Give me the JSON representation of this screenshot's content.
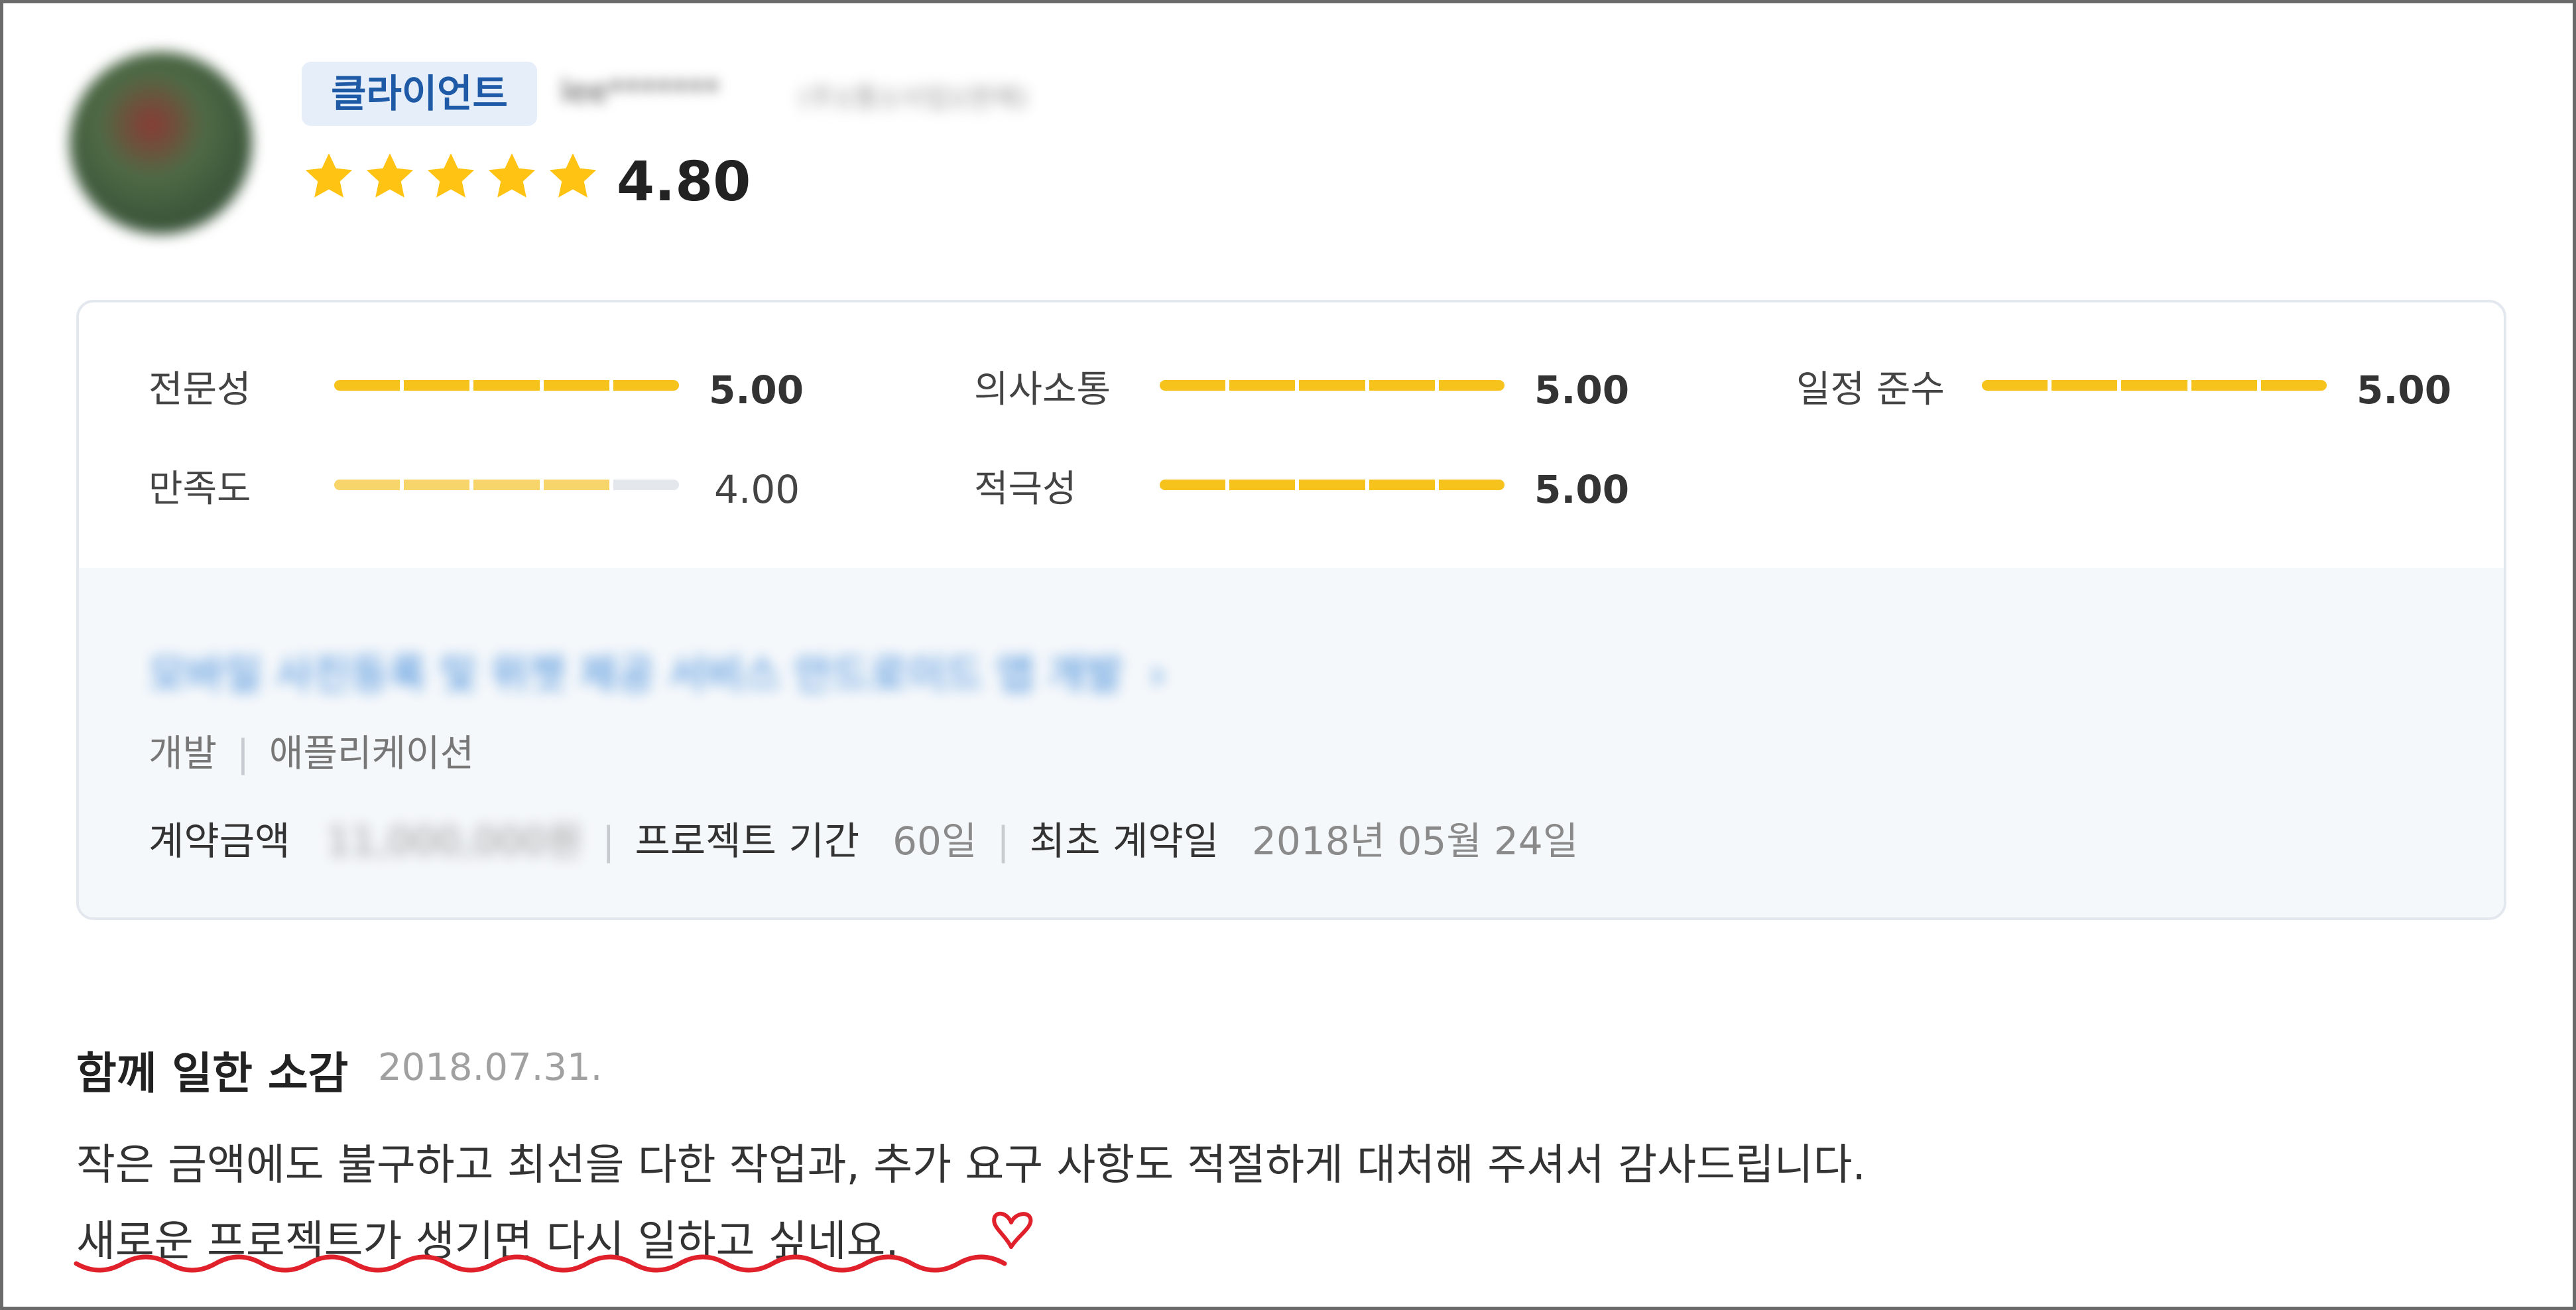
{
  "header": {
    "role_badge": "클라이언트",
    "reviewer_name": "lee*******",
    "reviewer_meta": "(주)(통)(사업)(판매)",
    "rating": "4.80",
    "star_count": 5,
    "star_color": "#FFC314"
  },
  "metrics": [
    {
      "label": "전문성",
      "value": "5.00",
      "fraction": 1.0
    },
    {
      "label": "의사소통",
      "value": "5.00",
      "fraction": 1.0
    },
    {
      "label": "일정 준수",
      "value": "5.00",
      "fraction": 1.0
    },
    {
      "label": "만족도",
      "value": "4.00",
      "fraction": 0.8
    },
    {
      "label": "적극성",
      "value": "5.00",
      "fraction": 1.0
    }
  ],
  "project": {
    "title": "모바일 사진등록 및 위젯 제공 서비스 안드로이드 앱 개발",
    "title_chevron": "›",
    "category": "개발",
    "subcategory": "애플리케이션",
    "amount_label": "계약금액",
    "amount_value": "11,000,000원",
    "period_label": "프로젝트 기간",
    "period_value": "60일",
    "first_contract_label": "최초 계약일",
    "first_contract_value": "2018년 05월 24일"
  },
  "review": {
    "title": "함께 일한 소감",
    "date": "2018.07.31.",
    "line1": "작은 금액에도 불구하고 최선을 다한 작업과, 추가 요구 사항도 적절하게 대처해 주셔서 감사드립니다.",
    "line2": "새로운 프로젝트가 생기면 다시 일하고 싶네요."
  },
  "colors": {
    "accent_blue": "#1f5aa6",
    "bar_yellow": "#f6c21c",
    "annotation_red": "#e0202a"
  }
}
